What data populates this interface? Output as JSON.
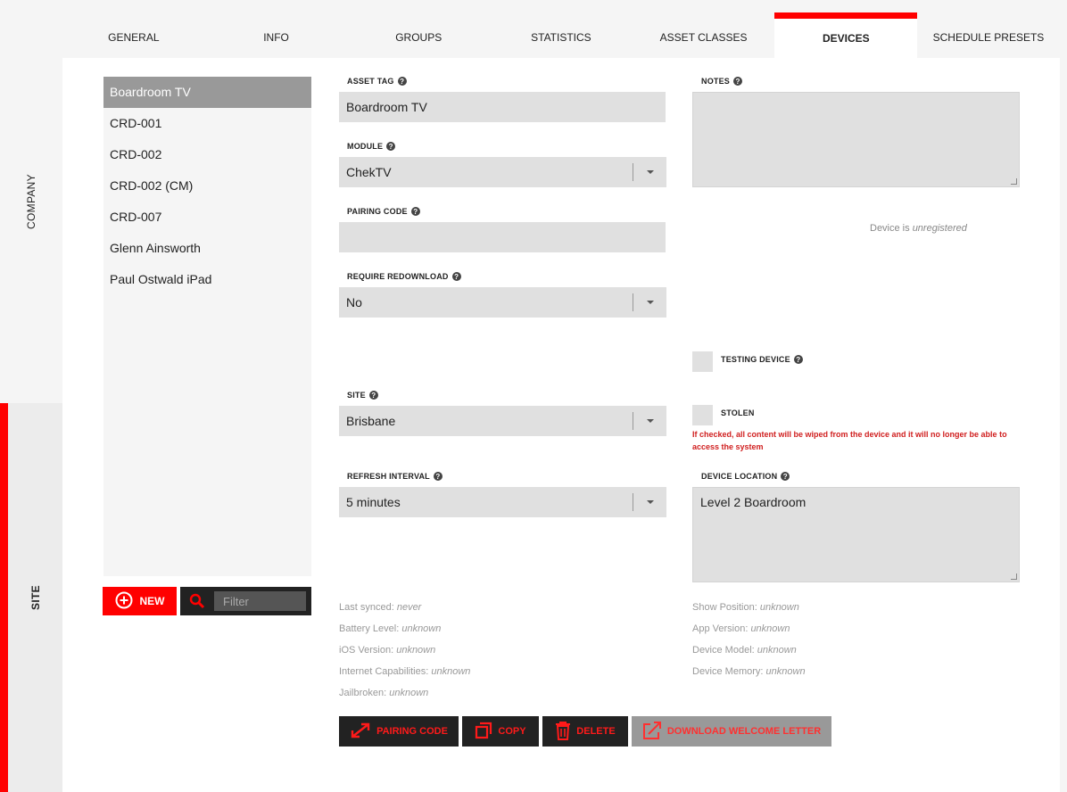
{
  "rail": {
    "company_label": "COMPANY",
    "site_label": "SITE"
  },
  "tabs": [
    {
      "label": "GENERAL"
    },
    {
      "label": "INFO"
    },
    {
      "label": "GROUPS"
    },
    {
      "label": "STATISTICS"
    },
    {
      "label": "ASSET CLASSES"
    },
    {
      "label": "DEVICES",
      "active": true
    },
    {
      "label": "SCHEDULE PRESETS"
    }
  ],
  "devices": [
    {
      "name": "Boardroom TV",
      "selected": true
    },
    {
      "name": "CRD-001"
    },
    {
      "name": "CRD-002"
    },
    {
      "name": "CRD-002 (CM)"
    },
    {
      "name": "CRD-007"
    },
    {
      "name": "Glenn Ainsworth"
    },
    {
      "name": "Paul Ostwald iPad"
    }
  ],
  "list_actions": {
    "new_label": "NEW",
    "filter_placeholder": "Filter"
  },
  "form": {
    "asset_tag": {
      "label": "ASSET TAG",
      "value": "Boardroom TV"
    },
    "module": {
      "label": "MODULE",
      "value": "ChekTV"
    },
    "pairing_code": {
      "label": "PAIRING CODE",
      "value": ""
    },
    "require_redownload": {
      "label": "REQUIRE REDOWNLOAD",
      "value": "No"
    },
    "site": {
      "label": "SITE",
      "value": "Brisbane"
    },
    "refresh_interval": {
      "label": "REFRESH INTERVAL",
      "value": "5 minutes"
    },
    "notes": {
      "label": "NOTES",
      "value": ""
    },
    "registration_prefix": "Device is ",
    "registration_status": "unregistered",
    "testing_device": {
      "label": "TESTING DEVICE",
      "checked": false
    },
    "stolen": {
      "label": "STOLEN",
      "checked": false,
      "warning": "If checked, all content will be wiped from the device and it will no longer be able to access the system"
    },
    "device_location": {
      "label": "DEVICE LOCATION",
      "value": "Level 2 Boardroom"
    }
  },
  "info_left": [
    {
      "label": "Last synced: ",
      "value": "never"
    },
    {
      "label": "Battery Level: ",
      "value": "unknown"
    },
    {
      "label": "iOS Version: ",
      "value": "unknown"
    },
    {
      "label": "Internet Capabilities: ",
      "value": "unknown"
    },
    {
      "label": "Jailbroken: ",
      "value": "unknown"
    }
  ],
  "info_right": [
    {
      "label": "Show Position: ",
      "value": "unknown"
    },
    {
      "label": "App Version: ",
      "value": "unknown"
    },
    {
      "label": "Device Model: ",
      "value": "unknown"
    },
    {
      "label": "Device Memory: ",
      "value": "unknown"
    }
  ],
  "actions": {
    "pairing_code": "PAIRING CODE",
    "copy": "COPY",
    "delete": "DELETE",
    "download_welcome_letter": "DOWNLOAD WELCOME LETTER"
  },
  "colors": {
    "accent": "#ff0000",
    "selected_item": "#999999",
    "field_bg": "#e0e0e0",
    "warning_text": "#d02020"
  }
}
